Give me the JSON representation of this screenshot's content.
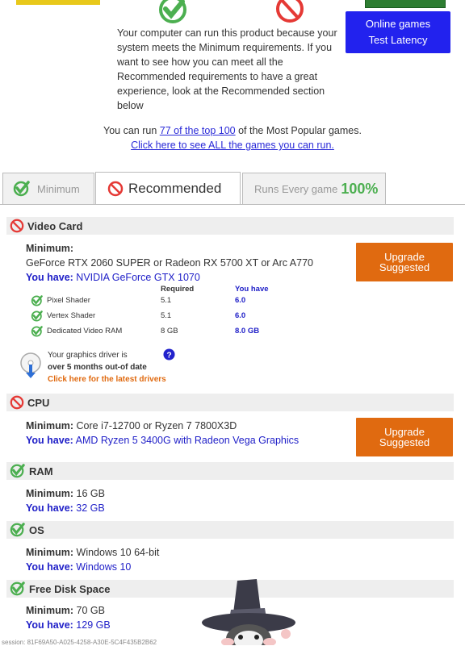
{
  "top": {
    "message": "Your computer can run this product because your system meets the Minimum requirements. If you want to see how you can meet all the Recommended requirements to have a great experience, look at the Recommended section below",
    "online_button": [
      "Online games",
      "Test Latency"
    ],
    "run_prefix": "You can run ",
    "run_link": "77 of the top 100",
    "run_suffix": " of the Most Popular games.",
    "see_all": "Click here to see ALL the games you can run."
  },
  "tabs": [
    {
      "label": "Minimum",
      "status": "pass"
    },
    {
      "label": "Recommended",
      "status": "fail",
      "active": true
    },
    {
      "label": "Runs Every game",
      "badge": "100%"
    }
  ],
  "video_card": {
    "title": "Video Card",
    "status": "fail",
    "min_label": "Minimum:",
    "min_value": "GeForce RTX 2060 SUPER or Radeon RX 5700 XT or Arc A770",
    "have_label": "You have:",
    "have_value": "NVIDIA GeForce GTX 1070",
    "upgrade": [
      "Upgrade",
      "Suggested"
    ],
    "table_headers": {
      "required": "Required",
      "have": "You have"
    },
    "rows": [
      {
        "name": "Pixel Shader",
        "required": "5.1",
        "have": "6.0"
      },
      {
        "name": "Vertex Shader",
        "required": "5.1",
        "have": "6.0"
      },
      {
        "name": "Dedicated Video RAM",
        "required": "8 GB",
        "have": "8.0 GB"
      }
    ],
    "driver": {
      "line1": "Your graphics driver is",
      "line2": "over 5 months out-of date",
      "link": "Click here for the latest drivers"
    }
  },
  "cpu": {
    "title": "CPU",
    "status": "fail",
    "min_label": "Minimum:",
    "min_value": "Core i7-12700 or Ryzen 7 7800X3D",
    "have_label": "You have:",
    "have_value": "AMD Ryzen 5 3400G with Radeon Vega Graphics",
    "upgrade": [
      "Upgrade",
      "Suggested"
    ]
  },
  "ram": {
    "title": "RAM",
    "status": "pass",
    "min_label": "Minimum:",
    "min_value": "16 GB",
    "have_label": "You have:",
    "have_value": "32 GB"
  },
  "os": {
    "title": "OS",
    "status": "pass",
    "min_label": "Minimum:",
    "min_value": "Windows 10 64-bit",
    "have_label": "You have:",
    "have_value": "Windows 10"
  },
  "disk": {
    "title": "Free Disk Space",
    "status": "pass",
    "min_label": "Minimum:",
    "min_value": "70 GB",
    "have_label": "You have:",
    "have_value": "129 GB"
  },
  "session": "session: 81F69A50-A025-4258-A30E-5C4F435B2B62",
  "colors": {
    "pass": "#4caf50",
    "fail": "#e53935",
    "link": "#2a2ad8",
    "upgrade": "#e06a10",
    "online": "#2222ee"
  }
}
